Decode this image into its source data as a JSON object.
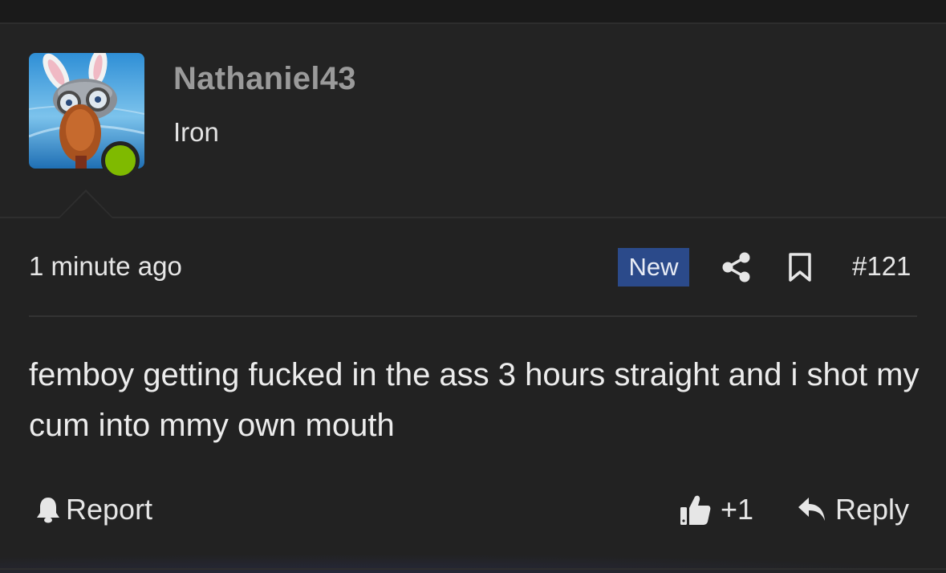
{
  "post": {
    "author": {
      "username": "Nathaniel43",
      "title": "Iron",
      "online": true,
      "avatar_icon": "rabbid-avatar-image"
    },
    "meta": {
      "timestamp": "1 minute ago",
      "badge": "New",
      "post_number": "#121",
      "share_icon": "share-icon",
      "bookmark_icon": "bookmark-icon"
    },
    "body": "femboy getting fucked in the ass 3 hours straight and i shot my cum into mmy own mouth",
    "actions": {
      "report_label": "Report",
      "like_count": "+1",
      "reply_label": "Reply"
    }
  },
  "colors": {
    "background": "#222222",
    "badge_bg": "#2b4a8a",
    "online": "#7fba00",
    "username": "#9a9a9a"
  }
}
